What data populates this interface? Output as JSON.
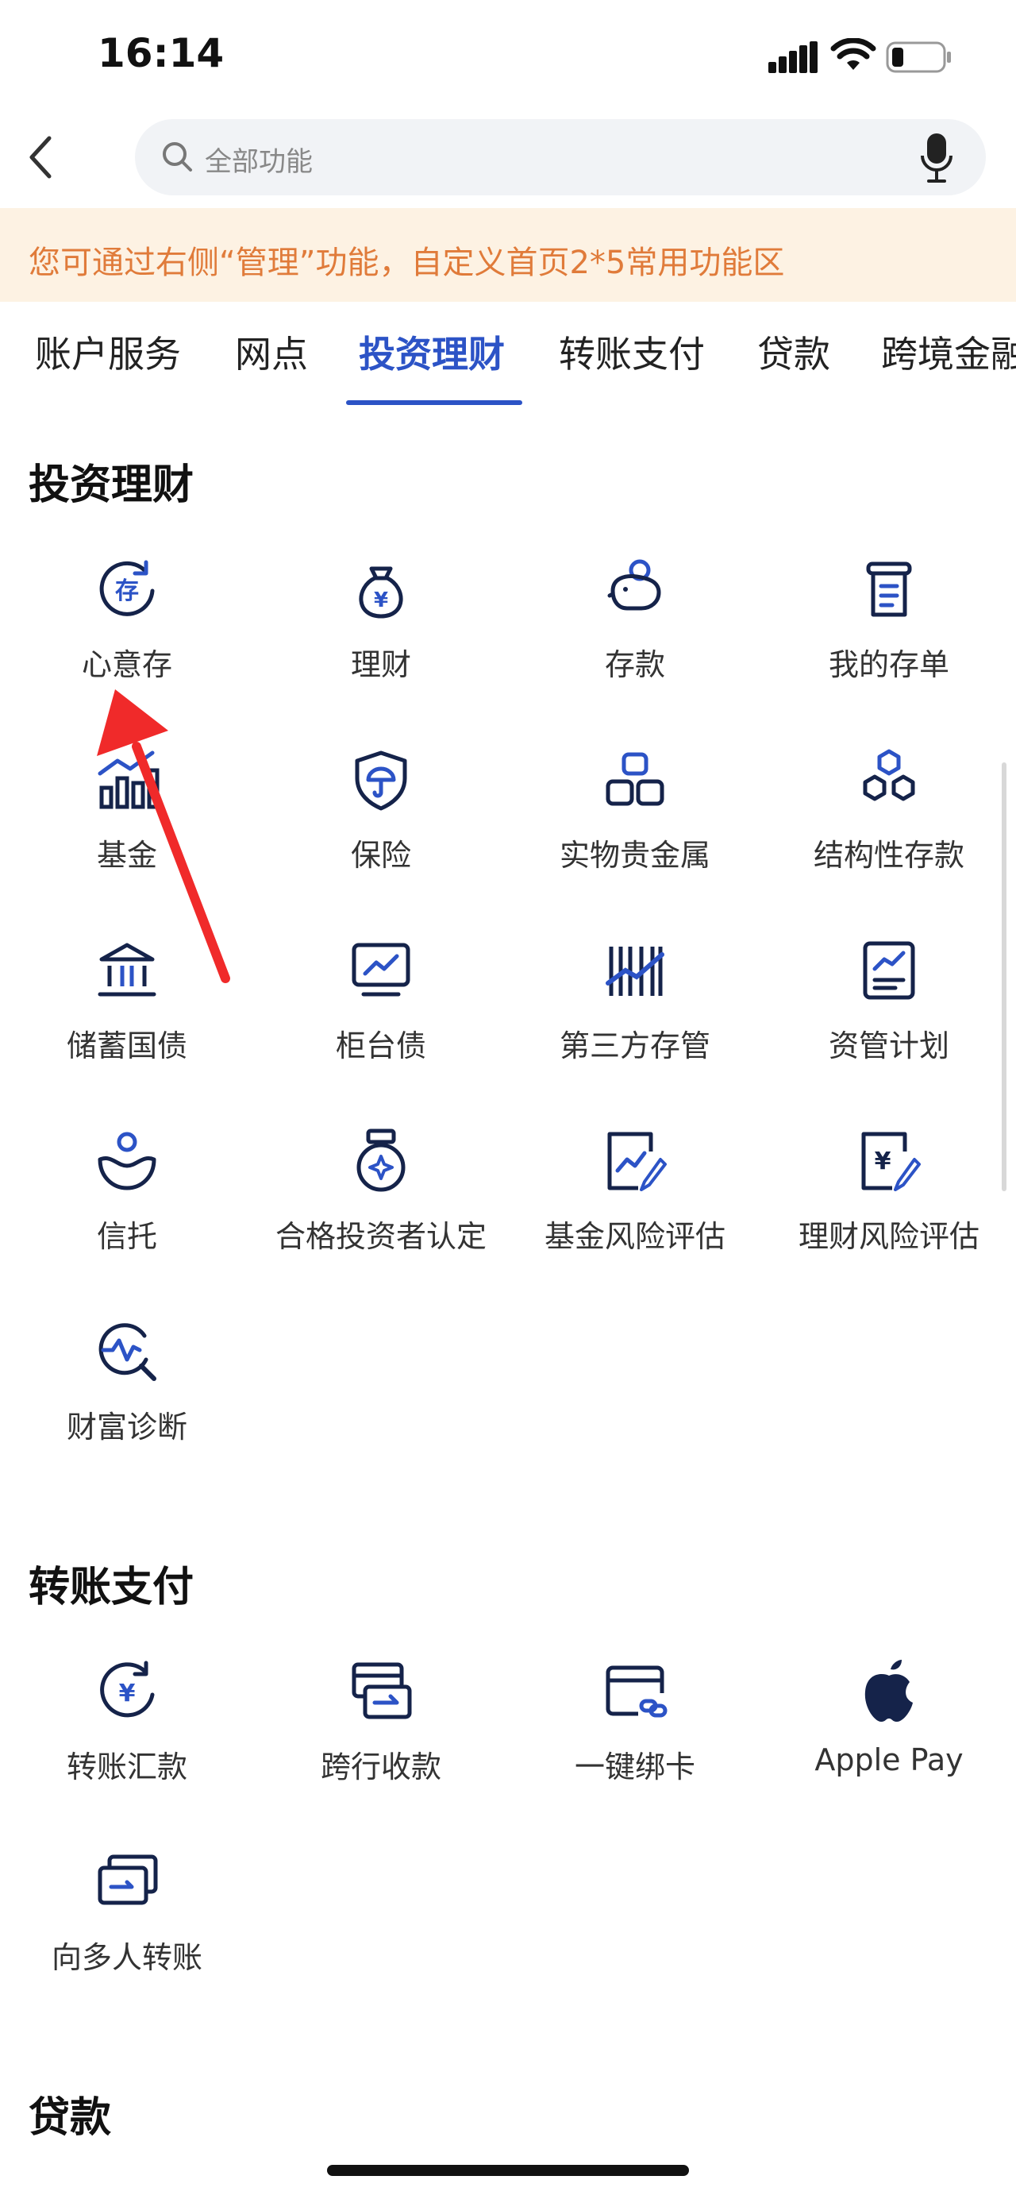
{
  "status_bar": {
    "time": "16:14"
  },
  "search": {
    "placeholder": "全部功能"
  },
  "tip": {
    "text": "您可通过右侧“管理”功能，自定义首页2*5常用功能区"
  },
  "tabs": [
    "账户服务",
    "网点",
    "投资理财",
    "转账支付",
    "贷款",
    "跨境金融"
  ],
  "active_tab": "投资理财",
  "sections": {
    "invest": {
      "title": "投资理财",
      "items": [
        "心意存",
        "理财",
        "存款",
        "我的存单",
        "基金",
        "保险",
        "实物贵金属",
        "结构性存款",
        "储蓄国债",
        "柜台债",
        "第三方存管",
        "资管计划",
        "信托",
        "合格投资者认定",
        "基金风险评估",
        "理财风险评估",
        "财富诊断"
      ]
    },
    "transfer": {
      "title": "转账支付",
      "items": [
        "转账汇款",
        "跨行收款",
        "一键绑卡",
        "Apple Pay",
        "向多人转账"
      ]
    },
    "loan": {
      "title": "贷款"
    }
  },
  "colors": {
    "accent": "#2c53c6",
    "icon_dark": "#15234a",
    "tip_bg": "#fdf2e3",
    "tip_text": "#e07b3a",
    "annotation": "#f02a2a"
  }
}
